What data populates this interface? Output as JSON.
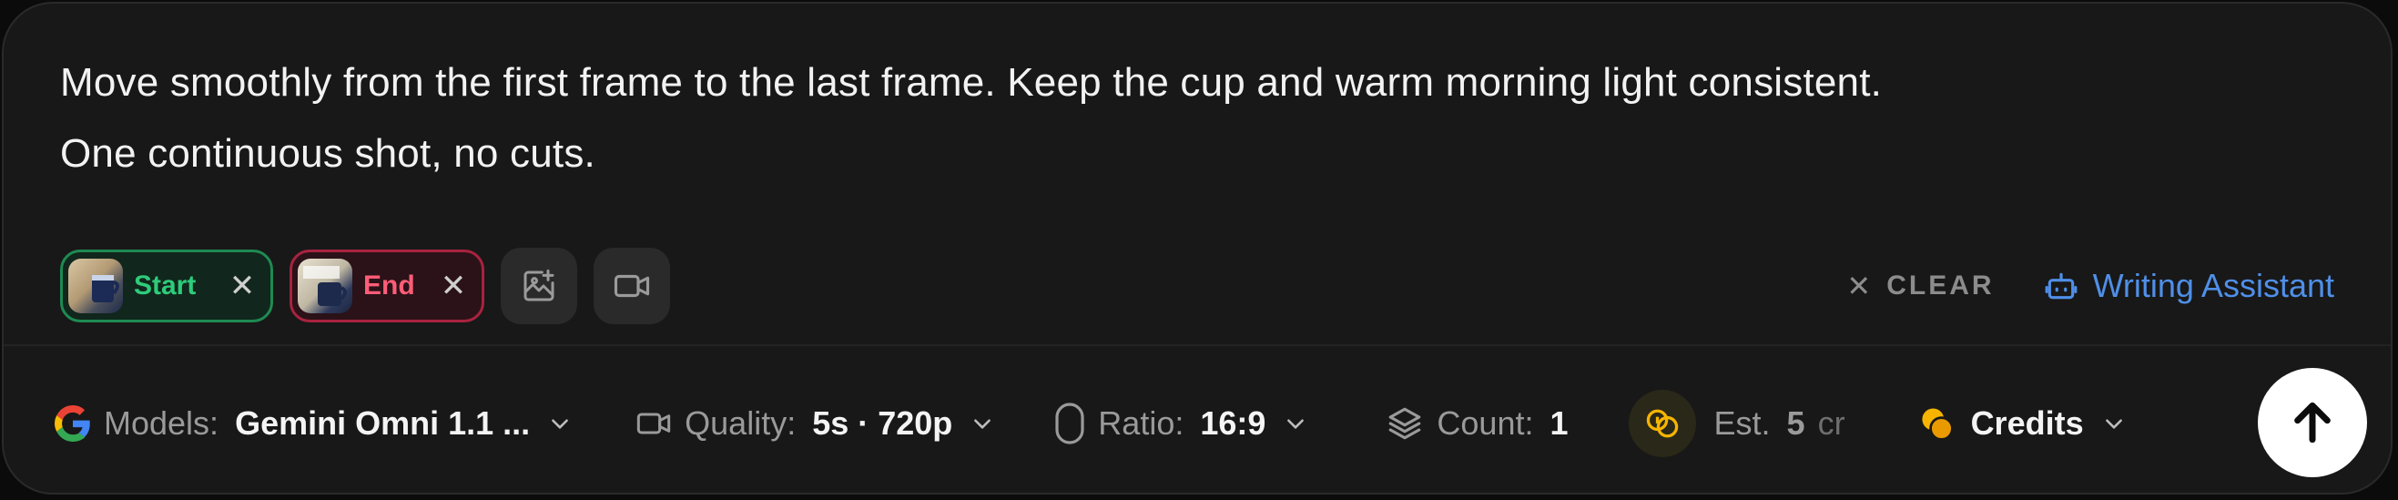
{
  "prompt": {
    "line1": "Move smoothly from the first frame to the last frame. Keep the cup and warm morning light consistent.",
    "line2": "One continuous shot, no cuts."
  },
  "attachments": {
    "start_label": "Start",
    "end_label": "End"
  },
  "tools": {
    "clear_label": "CLEAR",
    "assistant_label": "Writing Assistant"
  },
  "settings": {
    "models_label": "Models:",
    "models_value": "Gemini Omni 1.1 ...",
    "quality_label": "Quality:",
    "quality_value": "5s · 720p",
    "ratio_label": "Ratio:",
    "ratio_value": "16:9",
    "count_label": "Count:",
    "count_value": "1",
    "est_label": "Est.",
    "est_value": "5",
    "est_unit": "cr",
    "credits_label": "Credits"
  },
  "colors": {
    "start_accent": "#2ecb7a",
    "end_accent": "#ff5d78",
    "assistant_accent": "#4f8fe8",
    "credits_accent": "#f5b400"
  }
}
